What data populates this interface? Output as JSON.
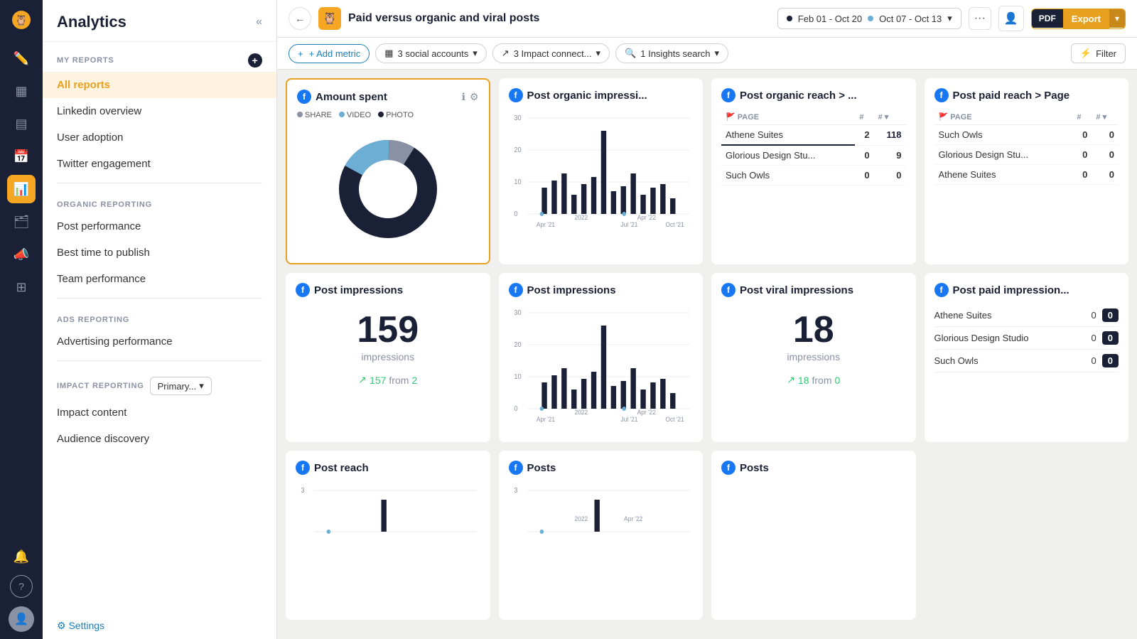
{
  "iconBar": {
    "items": [
      {
        "name": "compose-icon",
        "symbol": "✏",
        "active": false
      },
      {
        "name": "dashboard-icon",
        "symbol": "⊞",
        "active": false
      },
      {
        "name": "chart-icon",
        "symbol": "▤",
        "active": false
      },
      {
        "name": "calendar-icon",
        "symbol": "📅",
        "active": false
      },
      {
        "name": "analytics-icon",
        "symbol": "📊",
        "active": true
      },
      {
        "name": "briefcase-icon",
        "symbol": "🗂",
        "active": false
      },
      {
        "name": "megaphone-icon",
        "symbol": "📣",
        "active": false
      },
      {
        "name": "grid-icon",
        "symbol": "⊞",
        "active": false
      },
      {
        "name": "bell-icon",
        "symbol": "🔔",
        "active": false
      },
      {
        "name": "help-icon",
        "symbol": "?",
        "active": false
      }
    ]
  },
  "sidebar": {
    "title": "Analytics",
    "myReports": {
      "label": "MY REPORTS",
      "items": [
        {
          "label": "All reports",
          "active": true
        },
        {
          "label": "Linkedin overview",
          "active": false
        },
        {
          "label": "User adoption",
          "active": false
        },
        {
          "label": "Twitter engagement",
          "active": false
        }
      ]
    },
    "organicReporting": {
      "label": "ORGANIC REPORTING",
      "items": [
        {
          "label": "Post performance",
          "active": false
        },
        {
          "label": "Best time to publish",
          "active": false
        },
        {
          "label": "Team performance",
          "active": false
        }
      ]
    },
    "adsReporting": {
      "label": "ADS REPORTING",
      "items": [
        {
          "label": "Advertising performance",
          "active": false
        }
      ]
    },
    "impactReporting": {
      "label": "IMPACT REPORTING",
      "dropdownLabel": "Primary...",
      "items": [
        {
          "label": "Impact content",
          "active": false
        },
        {
          "label": "Audience discovery",
          "active": false
        }
      ]
    },
    "settings": "⚙ Settings"
  },
  "topbar": {
    "title": "Paid versus organic and viral posts",
    "dateRange1Label": "Feb 01 - Oct 20",
    "dateRange2Label": "Oct 07 - Oct 13",
    "exportPdf": "PDF",
    "exportLabel": "Export",
    "moreSymbol": "···",
    "caretSymbol": "▾"
  },
  "filterbar": {
    "addMetric": "+ Add metric",
    "socialAccounts": "3 social accounts",
    "impactConnect": "3 Impact connect...",
    "insightsSearch": "1 Insights search",
    "filter": "Filter"
  },
  "cards": {
    "amountSpent": {
      "title": "Amount spent",
      "legendShare": "SHARE",
      "legendVideo": "VIDEO",
      "legendPhoto": "PHOTO",
      "colors": {
        "share": "#8892a4",
        "video": "#6caed4",
        "photo": "#1a2035"
      }
    },
    "postOrganicImpressions": {
      "title": "Post organic impressi...",
      "xLabels": [
        "Apr '21",
        "Jul '21",
        "Oct '21"
      ],
      "yearLabel": "2022",
      "yearLabel2": "Apr '22",
      "yMax": 30,
      "yMid": 20,
      "yLow": 10
    },
    "postOrganicReach": {
      "title": "Post organic reach > ...",
      "colPage": "PAGE",
      "colHash1": "#",
      "colHash2": "#",
      "rows": [
        {
          "page": "Athene Suites",
          "val1": 2,
          "val2": 118
        },
        {
          "page": "Glorious Design Stu...",
          "val1": 0,
          "val2": 9
        },
        {
          "page": "Such Owls",
          "val1": 0,
          "val2": 0
        }
      ]
    },
    "postPaidReach": {
      "title": "Post paid reach > Page",
      "colPage": "PAGE",
      "colHash1": "#",
      "colHash2": "#",
      "rows": [
        {
          "page": "Such Owls",
          "val1": 0,
          "val2": 0
        },
        {
          "page": "Glorious Design Stu...",
          "val1": 0,
          "val2": 0
        },
        {
          "page": "Athene Suites",
          "val1": 0,
          "val2": 0
        }
      ]
    },
    "postImpressions1": {
      "title": "Post impressions",
      "value": "159",
      "label": "impressions",
      "changeValue": "157",
      "changeFrom": "from",
      "changeBase": "2"
    },
    "postImpressions2": {
      "title": "Post impressions",
      "xLabels": [
        "Apr '21",
        "Jul '21",
        "Oct '21"
      ],
      "yearLabel": "2022",
      "yearLabel2": "Apr '22",
      "yMax": 30,
      "yMid": 20,
      "yLow": 10
    },
    "postViralImpressions": {
      "title": "Post viral impressions",
      "value": "18",
      "label": "impressions",
      "changeValue": "18",
      "changeFrom": "from",
      "changeBase": "0"
    },
    "postPaidImpressions": {
      "title": "Post paid impression...",
      "rows": [
        {
          "page": "Athene Suites",
          "val": 0
        },
        {
          "page": "Glorious Design Studio",
          "val": 0
        },
        {
          "page": "Such Owls",
          "val": 0
        }
      ]
    },
    "postReach": {
      "title": "Post reach",
      "yVal": 3
    },
    "posts1": {
      "title": "Posts",
      "yearLabel": "2022",
      "yearLabel2": "Apr '22",
      "yVal": 3
    },
    "posts2": {
      "title": "Posts"
    }
  }
}
